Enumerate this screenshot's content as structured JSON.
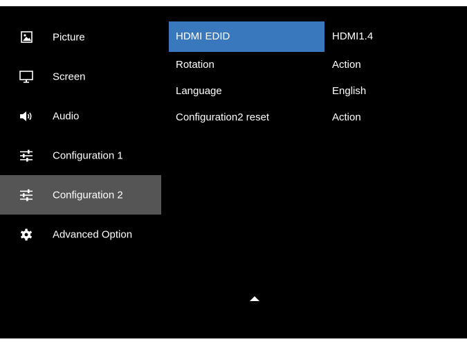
{
  "sidebar": {
    "items": [
      {
        "label": "Picture",
        "icon": "picture-icon"
      },
      {
        "label": "Screen",
        "icon": "monitor-icon"
      },
      {
        "label": "Audio",
        "icon": "speaker-icon"
      },
      {
        "label": "Configuration 1",
        "icon": "sliders-icon"
      },
      {
        "label": "Configuration 2",
        "icon": "sliders-icon",
        "selected": true
      },
      {
        "label": "Advanced Option",
        "icon": "gear-icon"
      }
    ]
  },
  "menu": {
    "rows": [
      {
        "name": "HDMI EDID",
        "value": "HDMI1.4",
        "selected": true
      },
      {
        "name": "Rotation",
        "value": "Action"
      },
      {
        "name": "Language",
        "value": "English"
      },
      {
        "name": "Configuration2 reset",
        "value": "Action"
      }
    ]
  },
  "colors": {
    "background": "#000000",
    "selected_sidebar": "#555555",
    "selected_row": "#3a78bd",
    "text": "#ffffff"
  }
}
